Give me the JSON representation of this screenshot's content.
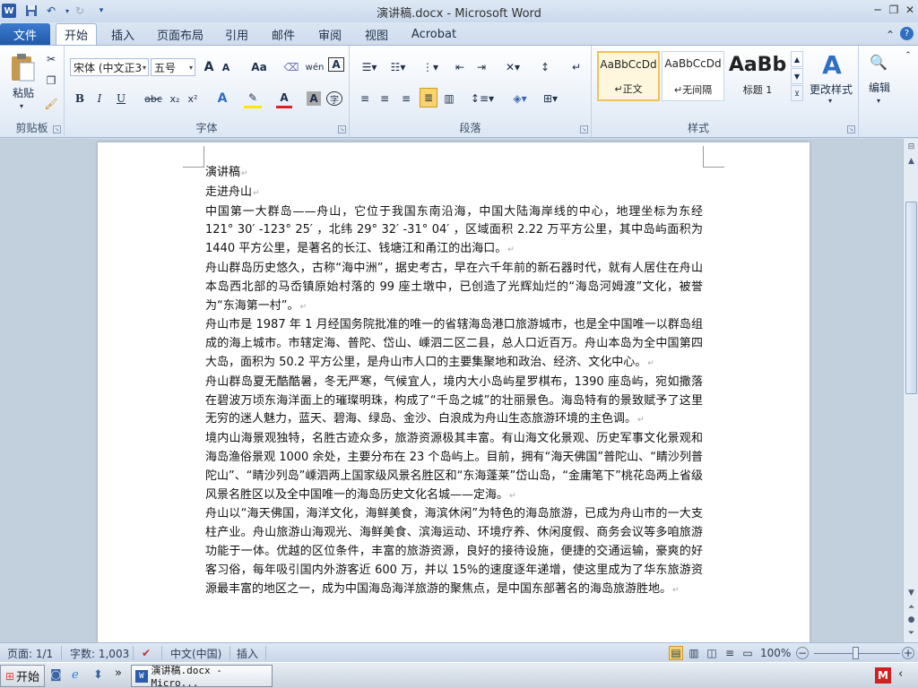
{
  "titlebar": {
    "title": "演讲稿.docx - Microsoft Word"
  },
  "tabs": {
    "file": "文件",
    "items": [
      "开始",
      "插入",
      "页面布局",
      "引用",
      "邮件",
      "审阅",
      "视图",
      "Acrobat"
    ],
    "active": "开始"
  },
  "ribbon": {
    "clipboard": {
      "paste": "粘贴",
      "label": "剪贴板"
    },
    "font": {
      "family": "宋体 (中文正3",
      "size": "五号",
      "label": "字体",
      "grow": "A",
      "shrink": "A",
      "case": "Aa",
      "bold": "B",
      "italic": "I",
      "underline": "U",
      "strike": "abc",
      "sub": "x₂",
      "sup": "x²"
    },
    "paragraph": {
      "label": "段落"
    },
    "styles": {
      "label": "样式",
      "items": [
        {
          "sample": "AaBbCcDd",
          "name": "↵正文"
        },
        {
          "sample": "AaBbCcDd",
          "name": "↵无间隔"
        },
        {
          "sample": "AaBb",
          "name": "标题 1"
        }
      ],
      "change": "更改样式"
    },
    "editing": {
      "label": "编辑"
    }
  },
  "document": {
    "paragraphs": [
      "演讲稿",
      "走进舟山",
      "中国第一大群岛——舟山，它位于我国东南沿海，中国大陆海岸线的中心，地理坐标为东经 121° 30′ -123° 25′ ，北纬 29° 32′ -31° 04′ ，区域面积 2.22 万平方公里，其中岛屿面积为 1440 平方公里，是著名的长江、钱塘江和甬江的出海口。",
      "舟山群岛历史悠久，古称“海中洲”，据史考古，早在六千年前的新石器时代，就有人居住在舟山本岛西北部的马岙镇原始村落的 99 座土墩中，已创造了光辉灿烂的“海岛河姆渡”文化，被誉为“东海第一村”。",
      "舟山市是 1987 年 1 月经国务院批准的唯一的省辖海岛港口旅游城市，也是全中国唯一以群岛组成的海上城市。市辖定海、普陀、岱山、嵊泗二区二县，总人口近百万。舟山本岛为全中国第四大岛，面积为 50.2 平方公里，是舟山市人口的主要集聚地和政治、经济、文化中心。",
      "舟山群岛夏无酷酷暑，冬无严寒，气候宜人，境内大小岛屿星罗棋布，1390 座岛屿，宛如撒落在碧波万顷东海洋面上的璀璨明珠，构成了“千岛之城”的壮丽景色。海岛特有的景致赋予了这里无穷的迷人魅力，蓝天、碧海、绿岛、金沙、白浪成为舟山生态旅游环境的主色调。",
      "境内山海景观独特，名胜古迹众多，旅游资源极其丰富。有山海文化景观、历史军事文化景观和海岛渔俗景观 1000 余处，主要分布在 23 个岛屿上。目前，拥有“海天佛国”普陀山、“睛沙列普陀山”、“睛沙列岛”嵊泗两上国家级风景名胜区和“东海蓬莱”岱山岛，“金庸笔下”桃花岛两上省级风景名胜区以及全中国唯一的海岛历史文化名城——定海。",
      "舟山以“海天佛国，海洋文化，海鲜美食，海滨休闲”为特色的海岛旅游，已成为舟山市的一大支柱产业。舟山旅游山海观光、海鲜美食、滨海运动、环境疗养、休闲度假、商务会议等多咱旅游功能于一体。优越的区位条件，丰富的旅游资源，良好的接待设施，便捷的交通运输，豪爽的好客习俗，每年吸引国内外游客近 600 万，并以 15%的速度逐年递增，使这里成为了华东旅游资源最丰富的地区之一，成为中国海岛海洋旅游的聚焦点，是中国东部著名的海岛旅游胜地。"
    ]
  },
  "statusbar": {
    "page": "页面: 1/1",
    "words": "字数: 1,003",
    "lang": "中文(中国)",
    "mode": "插入",
    "zoom": "100%"
  },
  "taskbar": {
    "start": "开始",
    "task": "演讲稿.docx - Micro..."
  }
}
